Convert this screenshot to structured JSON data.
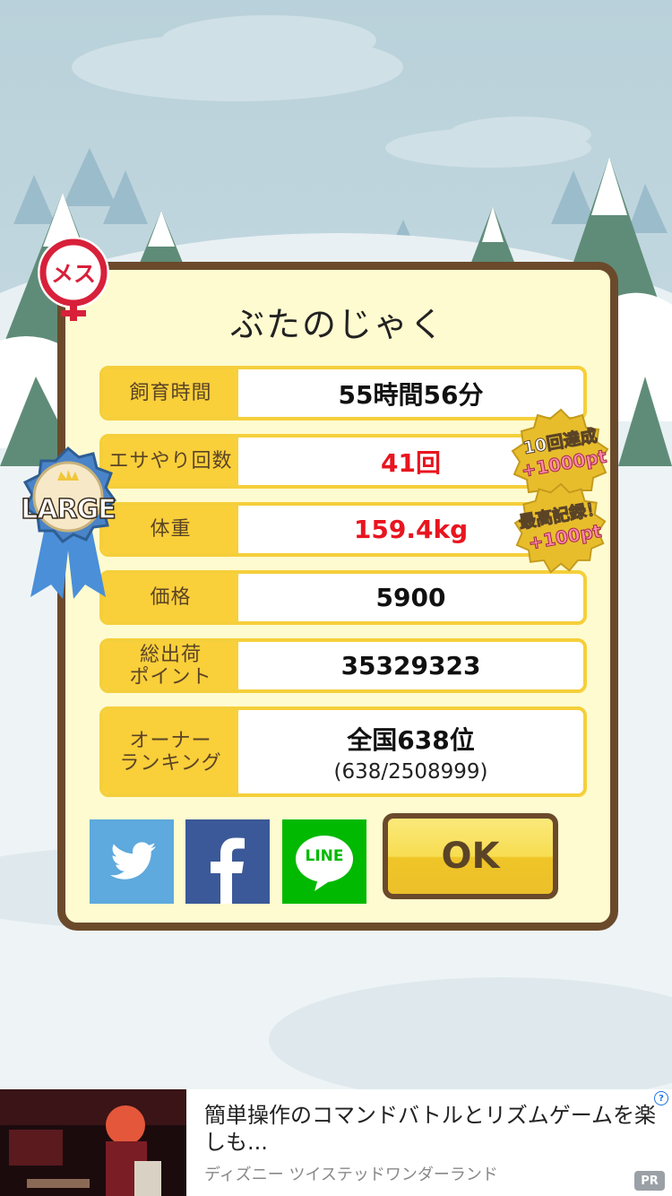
{
  "dialog": {
    "title": "ぶたのじゃく",
    "rows": [
      {
        "label": "飼育時間",
        "value": "55時間56分"
      },
      {
        "label": "エサやり回数",
        "value": "41回"
      },
      {
        "label": "体重",
        "value": "159.4kg"
      },
      {
        "label": "価格",
        "value": "5900"
      },
      {
        "label": "総出荷\nポイント",
        "value": "35329323"
      },
      {
        "label": "オーナー\nランキング",
        "value": "全国638位",
        "sub": "(638/2508999)"
      }
    ],
    "ok_label": "OK"
  },
  "badges": {
    "gender": "メス",
    "size": "LARGE",
    "bonus_feed": {
      "line1": "10回達成",
      "line2": "+1000pt"
    },
    "bonus_weight": {
      "line1": "最高記録！",
      "line2": "+100pt"
    }
  },
  "share": {
    "twitter_icon": "twitter-icon",
    "facebook_icon": "facebook-icon",
    "line_label": "LINE"
  },
  "ad": {
    "title": "簡単操作のコマンドバトルとリズムゲームを楽しも...",
    "source": "ディズニー ツイステッドワンダーランド",
    "pr_label": "PR"
  },
  "colors": {
    "accent_yellow": "#f9cf3a",
    "frame_brown": "#6b4a2c",
    "highlight_red": "#e8151f",
    "panel_cream": "#fffbd0",
    "twitter": "#5ea9dd",
    "facebook": "#3b5998",
    "line": "#00b900"
  }
}
